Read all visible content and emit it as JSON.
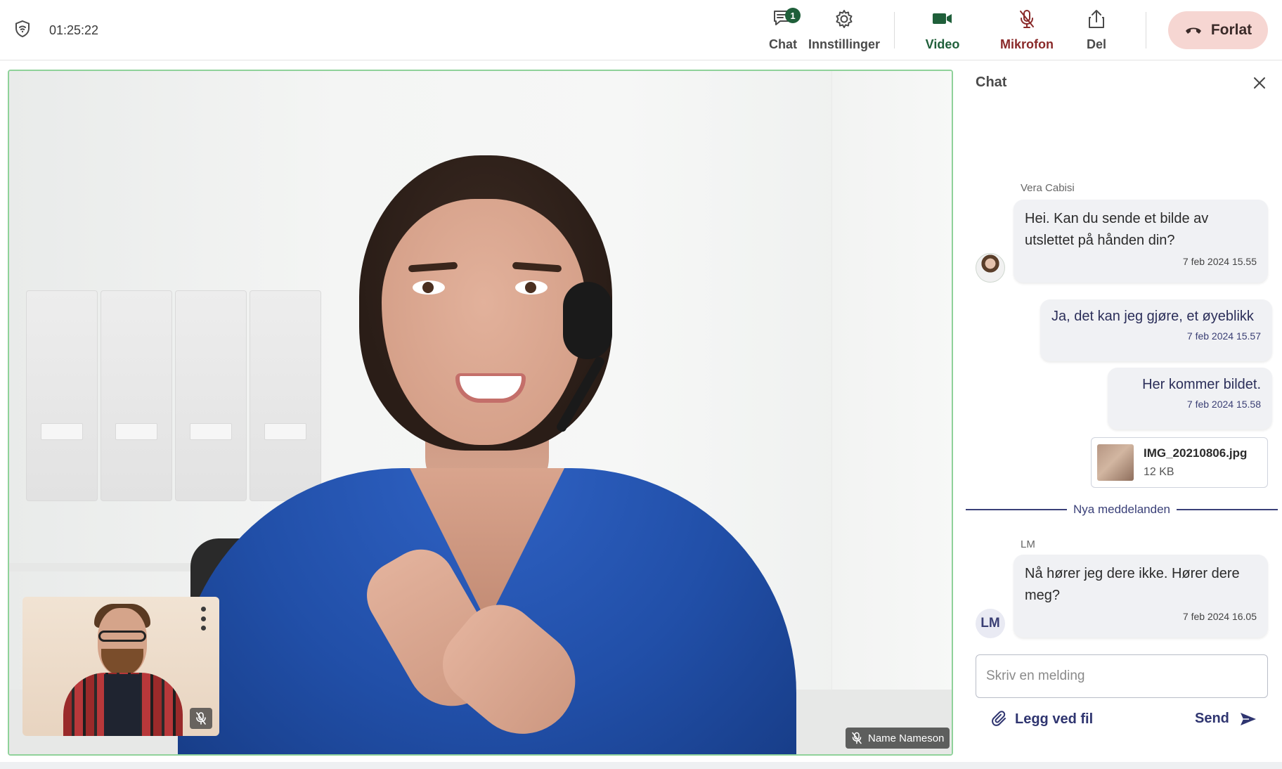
{
  "topbar": {
    "timer": "01:25:22",
    "chat": {
      "label": "Chat",
      "badge": "1"
    },
    "settings": {
      "label": "Innstillinger"
    },
    "video": {
      "label": "Video"
    },
    "microphone": {
      "label": "Mikrofon"
    },
    "share": {
      "label": "Del"
    },
    "leave": {
      "label": "Forlat"
    }
  },
  "stage": {
    "remote_participant_name": "Name Nameson"
  },
  "chat": {
    "title": "Chat",
    "messages": [
      {
        "sender": "Vera Cabisi",
        "text": "Hei. Kan du sende et bilde av utslettet på hånden din?",
        "time": "7 feb 2024 15.55",
        "direction": "in"
      },
      {
        "text": "Ja, det kan jeg gjøre, et øyeblikk",
        "time": "7 feb 2024 15.57",
        "direction": "out"
      },
      {
        "text": "Her kommer bildet.",
        "time": "7 feb 2024 15.58",
        "direction": "out"
      },
      {
        "sender": "LM",
        "text": "Nå hører jeg dere ikke. Hører dere meg?",
        "time": "7 feb 2024 16.05",
        "direction": "in",
        "avatar_initials": "LM"
      }
    ],
    "attachment": {
      "name": "IMG_20210806.jpg",
      "size": "12 KB"
    },
    "new_messages_divider": "Nya meddelanden",
    "input": {
      "placeholder": "Skriv en melding",
      "value": ""
    },
    "attach_label": "Legg ved fil",
    "send_label": "Send"
  },
  "colors": {
    "accent_green": "#1f5f3a",
    "mic_muted_red": "#8a2a2a",
    "leave_bg": "#f6d6d2",
    "chat_accent": "#2f3570",
    "stage_border": "#8fd29a"
  }
}
